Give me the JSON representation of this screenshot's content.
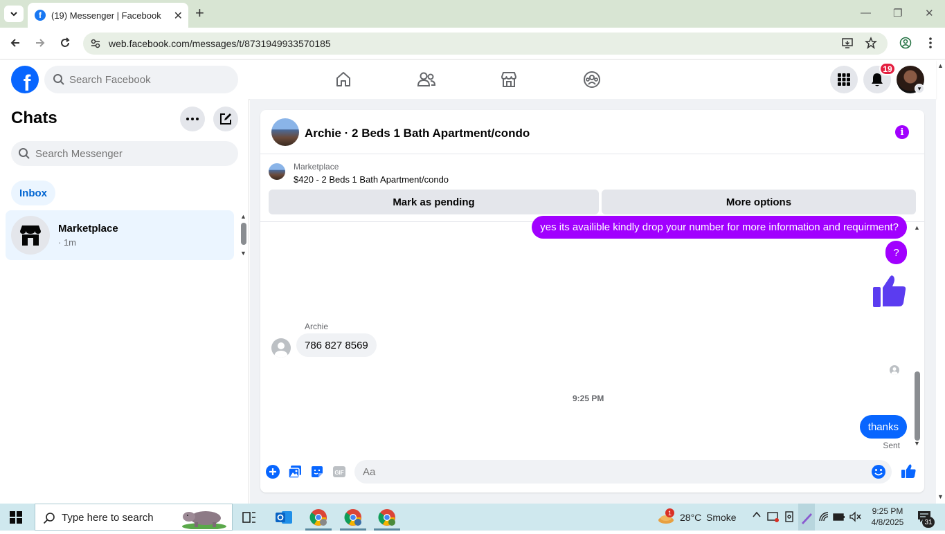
{
  "browser": {
    "tab_title": "(19) Messenger | Facebook",
    "url": "web.facebook.com/messages/t/8731949933570185",
    "favicon_letter": "f"
  },
  "fb_header": {
    "logo_letter": "f",
    "search_placeholder": "Search Facebook",
    "notification_count": "19",
    "icons": [
      "home-icon",
      "friends-icon",
      "marketplace-icon",
      "groups-icon",
      "menu-grid-icon",
      "bell-icon"
    ]
  },
  "sidebar": {
    "title": "Chats",
    "search_placeholder": "Search Messenger",
    "filter_label": "Inbox",
    "chats": [
      {
        "name": "Marketplace",
        "time": "· 1m"
      }
    ]
  },
  "conversation": {
    "title": "Archie · 2 Beds 1 Bath Apartment/condo",
    "listing": {
      "source": "Marketplace",
      "title": "$420 - 2 Beds 1 Bath Apartment/condo",
      "primary_action": "Mark as pending",
      "secondary_action": "More options"
    },
    "messages": [
      {
        "direction": "out",
        "text": "yes its availible kindly drop your number for more information and requirment?"
      },
      {
        "direction": "out",
        "text": "?"
      },
      {
        "direction": "out",
        "text": "thumbs-up"
      },
      {
        "direction": "in",
        "sender": "Archie",
        "text": "786 827 8569"
      },
      {
        "direction": "out",
        "text": "thanks"
      }
    ],
    "timestamp": "9:25 PM",
    "status": "Sent",
    "composer_placeholder": "Aa",
    "colors": {
      "accent_purple": "#a100ff",
      "accent_blue": "#0866ff"
    }
  },
  "taskbar": {
    "search_placeholder": "Type here to search",
    "weather_temp": "28°C",
    "weather_desc": "Smoke",
    "weather_badge": "1",
    "time": "9:25 PM",
    "date": "4/8/2025",
    "notification_count": "31"
  }
}
